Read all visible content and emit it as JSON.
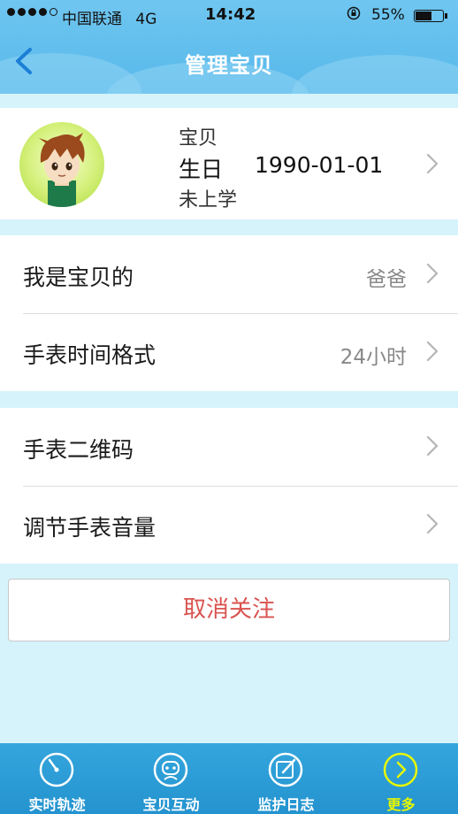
{
  "status_bar": {
    "carrier": "中国联通",
    "network": "4G",
    "time": "14:42",
    "battery": "55%",
    "battery_level": 0.55
  },
  "nav": {
    "title": "管理宝贝",
    "back_icon": "chevron-left-icon"
  },
  "profile": {
    "name": "宝贝",
    "birthday_label": "生日",
    "birthday_value": "1990-01-01",
    "school_status": "未上学",
    "avatar_icon": "cartoon-boy-avatar"
  },
  "settings_group_1": [
    {
      "label": "我是宝贝的",
      "value": "爸爸"
    },
    {
      "label": "手表时间格式",
      "value": "24小时"
    }
  ],
  "settings_group_2": [
    {
      "label": "手表二维码"
    },
    {
      "label": "调节手表音量"
    }
  ],
  "unfollow_button": "取消关注",
  "tabbar": [
    {
      "label": "实时轨迹",
      "icon": "speedometer-icon",
      "active": false
    },
    {
      "label": "宝贝互动",
      "icon": "robot-face-icon",
      "active": false
    },
    {
      "label": "监护日志",
      "icon": "edit-note-icon",
      "active": false
    },
    {
      "label": "更多",
      "icon": "chevron-circle-icon",
      "active": true
    }
  ],
  "colors": {
    "nav_bg": "#57b8ea",
    "page_bg": "#d6f3fb",
    "tab_bg": "#2493cf",
    "active_tab": "#e8f700",
    "unfollow_text": "#d9534f"
  }
}
